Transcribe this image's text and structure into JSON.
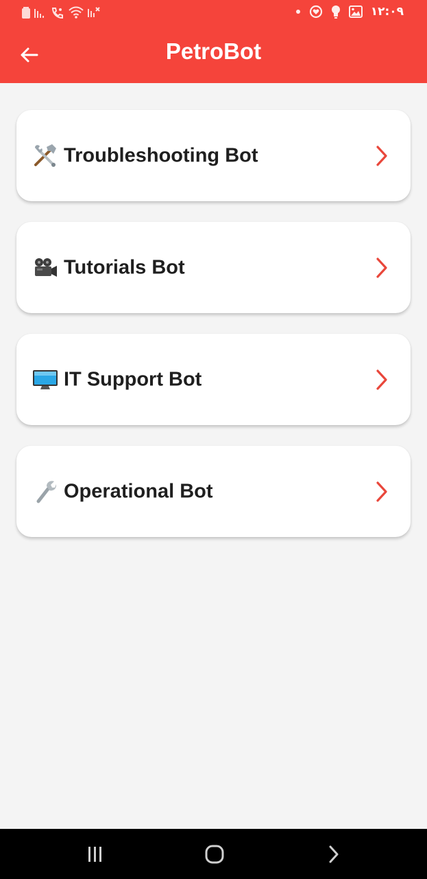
{
  "status_bar": {
    "time": "١٢:٠٩",
    "left_icons": [
      "battery-icon",
      "signal-icon",
      "wifi-calling-icon",
      "wifi-icon",
      "signal-muted-icon"
    ],
    "right_icons": [
      "dot-icon",
      "heart-circle-icon",
      "bulb-icon",
      "image-icon"
    ]
  },
  "app_bar": {
    "title": "PetroBot",
    "back_icon": "arrow-left-icon",
    "color": "#f5443b"
  },
  "bots": [
    {
      "label": "Troubleshooting Bot",
      "icon": "hammer-wrench-icon"
    },
    {
      "label": "Tutorials Bot",
      "icon": "movie-camera-icon"
    },
    {
      "label": "IT Support Bot",
      "icon": "computer-monitor-icon"
    },
    {
      "label": "Operational Bot",
      "icon": "wrench-icon"
    }
  ],
  "chevron_color": "#e9473b",
  "nav_bar": {
    "buttons": [
      "recent-apps-icon",
      "home-icon",
      "back-icon"
    ]
  }
}
